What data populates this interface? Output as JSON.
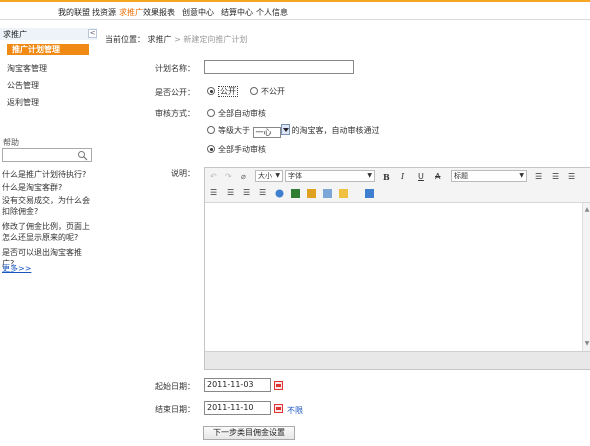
{
  "nav": {
    "items": [
      "我的联盟",
      "找资源",
      "求推广",
      "效果报表",
      "创意中心",
      "结算中心",
      "个人信息"
    ],
    "active_index": 2
  },
  "sidebar": {
    "title": "求推广",
    "collapse_glyph": "<",
    "items": [
      "推广计划管理",
      "淘宝客管理",
      "公告管理",
      "返利管理"
    ],
    "active_index": 0
  },
  "help": {
    "title": "帮助",
    "search_value": "",
    "links": [
      "什么是推广计划待执行?",
      "什么是淘宝客群?",
      "没有交易成交，为什么会扣除佣金?",
      "修改了佣金比例，页面上怎么还显示原来的呢?",
      "是否可以退出淘宝客推广?"
    ],
    "more": "更多>>"
  },
  "breadcrumb": {
    "prefix": "当前位置：",
    "parent": "求推广",
    "sep": ">",
    "current": "新建定向推广计划"
  },
  "form": {
    "plan_name_label": "计划名称：",
    "plan_name_value": "",
    "public_label": "是否公开：",
    "public_options": [
      "公开",
      "不公开"
    ],
    "public_selected": 0,
    "audit_label": "审核方式：",
    "audit_auto": "全部自动审核",
    "audit_level_pre": "等级大于",
    "audit_level_value": "一心",
    "audit_level_post": "的淘宝客，自动审核通过",
    "audit_manual": "全部手动审核",
    "audit_selected": 2,
    "desc_label": "说明：",
    "start_label": "起始日期：",
    "start_value": "2011-11-03",
    "end_label": "结束日期：",
    "end_value": "2011-11-10",
    "no_limit": "不限",
    "next_button": "下一步类目佣金设置"
  },
  "editor": {
    "font_size": "大小",
    "font_face": "字体",
    "heading": "标题",
    "bold": "B",
    "italic": "I",
    "underline": "U",
    "strike": "A",
    "icon_colors": [
      "#f0c040",
      "#2e7d32",
      "#e0a020",
      "#3f7fd0",
      "#7aa7d8"
    ]
  }
}
